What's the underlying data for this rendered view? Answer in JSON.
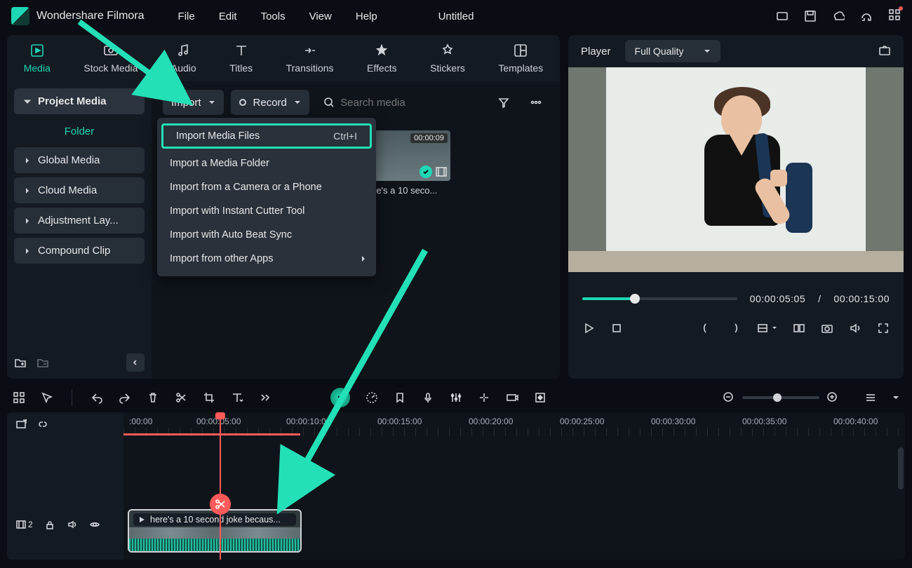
{
  "app": {
    "title": "Wondershare Filmora",
    "document": "Untitled"
  },
  "menus": [
    "File",
    "Edit",
    "Tools",
    "View",
    "Help"
  ],
  "tabs": [
    {
      "label": "Media",
      "active": true
    },
    {
      "label": "Stock Media"
    },
    {
      "label": "Audio"
    },
    {
      "label": "Titles"
    },
    {
      "label": "Transitions"
    },
    {
      "label": "Effects"
    },
    {
      "label": "Stickers"
    },
    {
      "label": "Templates"
    }
  ],
  "sidebar": {
    "project": "Project Media",
    "folder": "Folder",
    "items": [
      "Global Media",
      "Cloud Media",
      "Adjustment Lay...",
      "Compound Clip"
    ]
  },
  "toolbar": {
    "import": "Import",
    "record": "Record",
    "search_placeholder": "Search media"
  },
  "import_menu": {
    "items": [
      {
        "label": "Import Media Files",
        "shortcut": "Ctrl+I",
        "highlight": true
      },
      {
        "label": "Import a Media Folder"
      },
      {
        "label": "Import from a Camera or a Phone"
      },
      {
        "label": "Import with Instant Cutter Tool"
      },
      {
        "label": "Import with Auto Beat Sync"
      },
      {
        "label": "Import from other Apps",
        "submenu": true
      }
    ]
  },
  "thumb": {
    "duration": "00:00:09",
    "caption": "re's a 10 seco..."
  },
  "player": {
    "label": "Player",
    "quality": "Full Quality",
    "current": "00:00:05:05",
    "sep": "/",
    "total": "00:00:15:00"
  },
  "timeline": {
    "ticks": [
      ":00:00",
      "00:00:05:00",
      "00:00:10:00",
      "00:00:15:00",
      "00:00:20:00",
      "00:00:25:00",
      "00:00:30:00",
      "00:00:35:00",
      "00:00:40:00"
    ],
    "track_badge": "2",
    "clip_label": "here's a 10 second joke becaus..."
  }
}
